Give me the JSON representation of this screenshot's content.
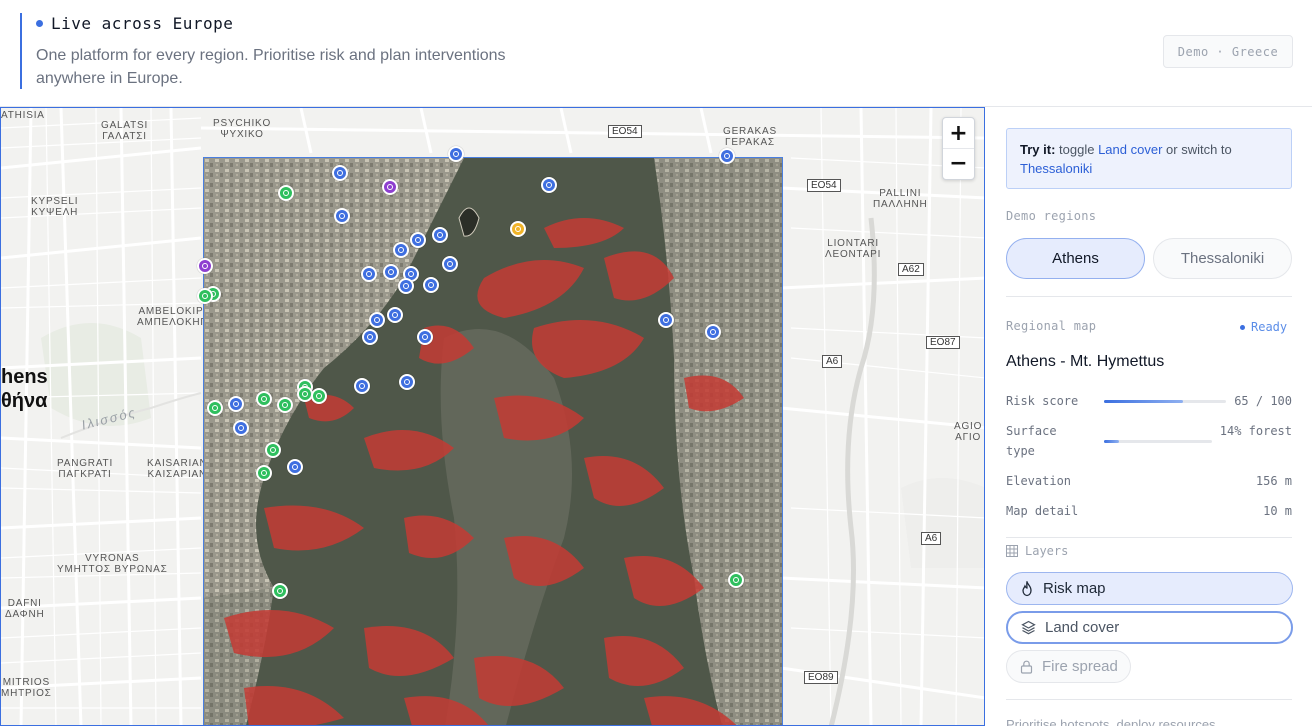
{
  "header": {
    "live_title": "Live across Europe",
    "description": "One platform for every region. Prioritise risk and plan interventions anywhere in Europe.",
    "demo_badge": "Demo · Greece"
  },
  "map": {
    "zoom_in": "+",
    "zoom_out": "−",
    "labels": [
      {
        "text": "ATHISIA"
      },
      {
        "text": "GALATSI\nΓΑΛΑΤΣΙ"
      },
      {
        "text": "PSYCHIKO\nΨΥΧΙΚΟ"
      },
      {
        "text": "GERAKAS\nΓΕΡΑΚΑΣ"
      },
      {
        "text": "KYPSELI\nΚΥΨΕΛΗ"
      },
      {
        "text": "PALLINI\nΠΑΛΛΗΝΗ"
      },
      {
        "text": "LIONTARI\nΛΕΟΝΤΑΡΙ"
      },
      {
        "text": "AMBELOKIPI\nΑΜΠΕΛΟΚΗΠ"
      },
      {
        "text": "AGIO\nΑΓΙΟ"
      },
      {
        "text": "PANGRATI\nΠΑΓΚΡΑΤΙ"
      },
      {
        "text": "KAISARIAN\nΚΑΙΣΑΡΙΑΝ"
      },
      {
        "text": "VYRONAS\nΥΜΗΤΤΟΣ ΒΥΡΩΝΑΣ"
      },
      {
        "text": "DAFNI\nΔΑΦΝΗ"
      },
      {
        "text": "MITRIOS\nΜΗΤΡΙΟΣ"
      }
    ],
    "city_label": "hens\nθήνα",
    "river_label": "Ιλισσός",
    "shields": [
      "EO54",
      "EO54",
      "A62",
      "EO87",
      "A6",
      "A6",
      "EO89"
    ],
    "marker_colors": {
      "blue": "#3f6fe0",
      "green": "#2fbf5e",
      "purple": "#8e3fd0",
      "yellow": "#f0b429"
    }
  },
  "panel": {
    "tryit_prefix": "Try it:",
    "tryit_mid1": "toggle",
    "tryit_link1": "Land cover",
    "tryit_mid2": "or switch to",
    "tryit_link2": "Thessaloniki",
    "demo_regions_label": "Demo regions",
    "regions": [
      {
        "label": "Athens",
        "active": true
      },
      {
        "label": "Thessaloniki",
        "active": false
      }
    ],
    "regional_map_label": "Regional map",
    "status": "Ready",
    "region_title": "Athens - Mt. Hymettus",
    "metrics": {
      "risk": {
        "label": "Risk score",
        "value": "65 / 100",
        "fraction": 0.65
      },
      "surface": {
        "label": "Surface\ntype",
        "value": "14% forest",
        "fraction": 0.14
      },
      "elevation": {
        "label": "Elevation",
        "value": "156 m"
      },
      "detail": {
        "label": "Map detail",
        "value": "10 m"
      }
    },
    "layers_label": "Layers",
    "layers": [
      {
        "label": "Risk map"
      },
      {
        "label": "Land cover"
      },
      {
        "label": "Fire spread"
      }
    ],
    "footer_text": "Prioritise hotspots, deploy resources"
  }
}
